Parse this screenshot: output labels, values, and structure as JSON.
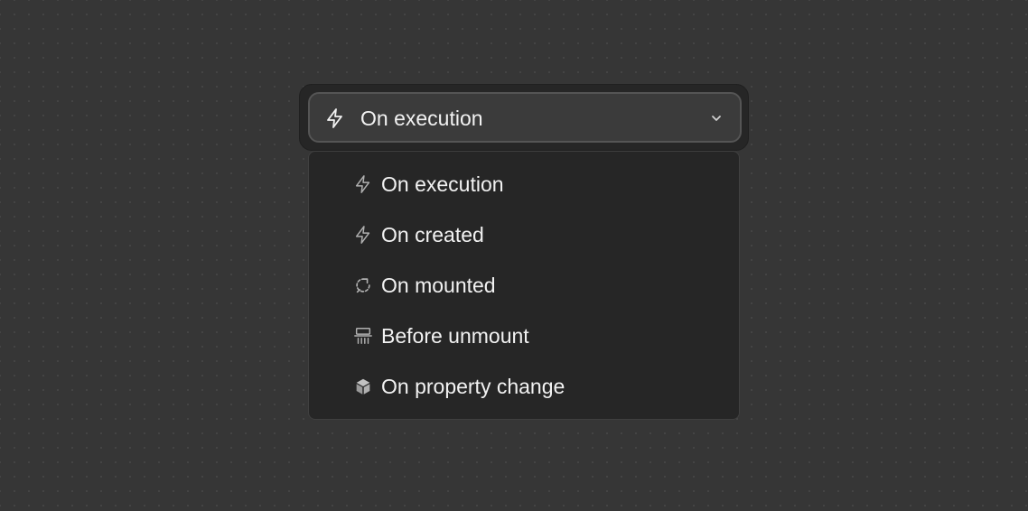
{
  "select": {
    "value": "On execution",
    "value_icon": "lightning-icon",
    "expanded": true
  },
  "menu": {
    "items": [
      {
        "label": "On execution",
        "icon": "lightning-icon"
      },
      {
        "label": "On created",
        "icon": "lightning-icon"
      },
      {
        "label": "On mounted",
        "icon": "refresh-dashed-icon"
      },
      {
        "label": "Before unmount",
        "icon": "shredder-icon"
      },
      {
        "label": "On property change",
        "icon": "cube-icon"
      }
    ]
  },
  "colors": {
    "background": "#363636",
    "trigger_bg": "#3b3b3b",
    "menu_bg": "#262626",
    "text": "#f2f2f2",
    "icon_muted": "#b0b0b0"
  }
}
